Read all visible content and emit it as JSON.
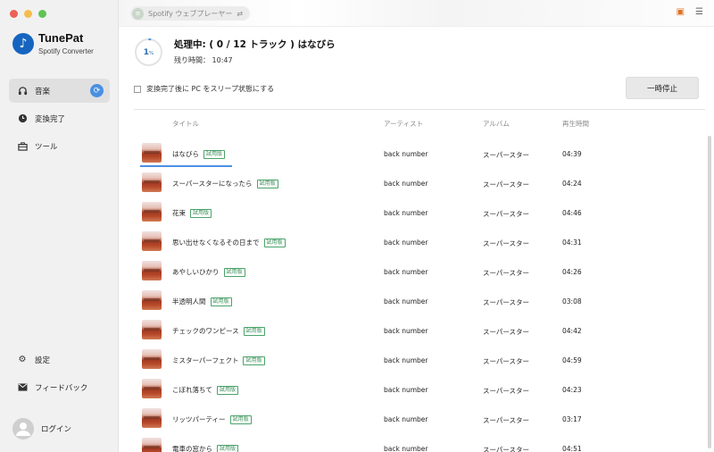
{
  "app": {
    "name": "TunePat",
    "subtitle": "Spotify Converter"
  },
  "sidebar": {
    "items": [
      {
        "label": "音楽",
        "icon": "headphones-icon"
      },
      {
        "label": "変換完了",
        "icon": "clock-icon"
      },
      {
        "label": "ツール",
        "icon": "toolbox-icon"
      }
    ],
    "bottom_items": [
      {
        "label": "設定",
        "icon": "gear-icon"
      },
      {
        "label": "フィードバック",
        "icon": "mail-icon"
      }
    ],
    "login_label": "ログイン"
  },
  "topbar": {
    "player_label": "Spotify ウェブプレーヤー",
    "swap_icon": "⇄"
  },
  "status": {
    "progress_percent": 1,
    "progress_number": "1",
    "progress_unit": "%",
    "title": "処理中: ( 0 / 12 トラック ) はなびら",
    "remaining": "残り時間：  10:47"
  },
  "options": {
    "sleep_label": "変換完了後に PC をスリープ状態にする",
    "pause_label": "一時停止"
  },
  "table": {
    "headers": {
      "title": "タイトル",
      "artist": "アーティスト",
      "album": "アルバム",
      "duration": "再生時間"
    },
    "trial_badge": "試用版",
    "rows": [
      {
        "title": "はなびら",
        "artist": "back number",
        "album": "スーパースター",
        "duration": "04:39"
      },
      {
        "title": "スーパースターになったら",
        "artist": "back number",
        "album": "スーパースター",
        "duration": "04:24"
      },
      {
        "title": "花束",
        "artist": "back number",
        "album": "スーパースター",
        "duration": "04:46"
      },
      {
        "title": "思い出せなくなるその日まで",
        "artist": "back number",
        "album": "スーパースター",
        "duration": "04:31"
      },
      {
        "title": "あやしいひかり",
        "artist": "back number",
        "album": "スーパースター",
        "duration": "04:26"
      },
      {
        "title": "半透明人間",
        "artist": "back number",
        "album": "スーパースター",
        "duration": "03:08"
      },
      {
        "title": "チェックのワンピース",
        "artist": "back number",
        "album": "スーパースター",
        "duration": "04:42"
      },
      {
        "title": "ミスターパーフェクト",
        "artist": "back number",
        "album": "スーパースター",
        "duration": "04:59"
      },
      {
        "title": "こぼれ落ちて",
        "artist": "back number",
        "album": "スーパースター",
        "duration": "04:23"
      },
      {
        "title": "リッツパーティー",
        "artist": "back number",
        "album": "スーパースター",
        "duration": "03:17"
      },
      {
        "title": "電車の窓から",
        "artist": "back number",
        "album": "スーパースター",
        "duration": "04:51"
      }
    ]
  },
  "colors": {
    "accent": "#4a90e2",
    "trial_green": "#3a8f58"
  }
}
